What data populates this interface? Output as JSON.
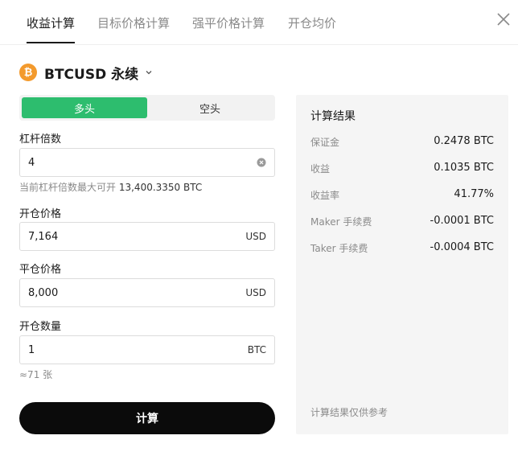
{
  "tabs": [
    {
      "label": "收益计算",
      "active": true
    },
    {
      "label": "目标价格计算",
      "active": false
    },
    {
      "label": "强平价格计算",
      "active": false
    },
    {
      "label": "开仓均价",
      "active": false
    }
  ],
  "pair": {
    "coin_symbol": "₿",
    "name": "BTCUSD 永续"
  },
  "side": {
    "long": "多头",
    "short": "空头",
    "selected": "long"
  },
  "leverage": {
    "label": "杠杆倍数",
    "value": "4",
    "hint_prefix": "当前杠杆倍数最大可开",
    "hint_value": "13,400.3350 BTC"
  },
  "open_price": {
    "label": "开仓价格",
    "value": "7,164",
    "unit": "USD"
  },
  "close_price": {
    "label": "平仓价格",
    "value": "8,000",
    "unit": "USD"
  },
  "quantity": {
    "label": "开仓数量",
    "value": "1",
    "unit": "BTC",
    "hint": "≈71 张"
  },
  "calculate_label": "计算",
  "result": {
    "title": "计算结果",
    "rows": [
      {
        "label": "保证金",
        "value": "0.2478 BTC"
      },
      {
        "label": "收益",
        "value": "0.1035 BTC"
      },
      {
        "label": "收益率",
        "value": "41.77%"
      },
      {
        "label": "Maker 手续费",
        "value": "-0.0001 BTC"
      },
      {
        "label": "Taker 手续费",
        "value": "-0.0004 BTC"
      }
    ],
    "note": "计算结果仅供参考"
  },
  "colors": {
    "long_green": "#2dbd6e",
    "coin_orange": "#f39a2d",
    "button_black": "#0b0b0b",
    "panel_bg": "#f5f5f5"
  },
  "icons": {
    "close": "close-icon",
    "chevron": "chevron-down-icon",
    "clear": "clear-icon",
    "coin": "bitcoin-icon"
  }
}
